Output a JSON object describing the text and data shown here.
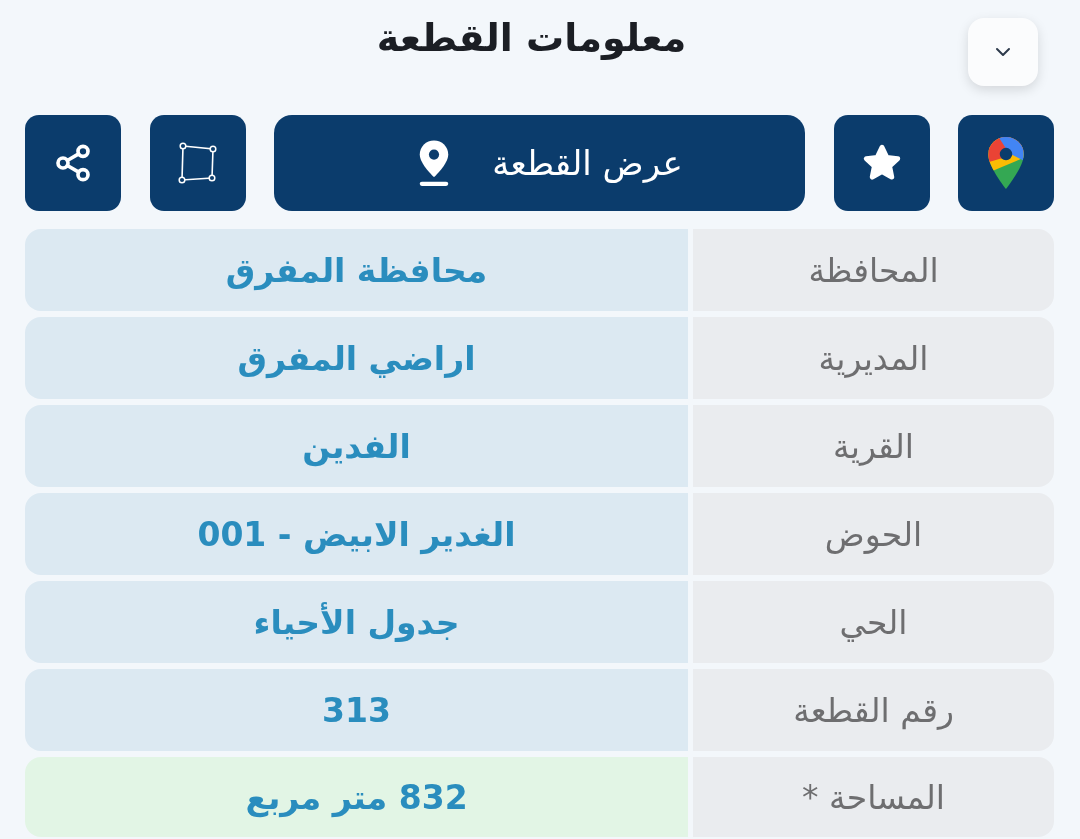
{
  "header": {
    "title": "معلومات القطعة"
  },
  "actions": [
    {
      "kind": "maps"
    },
    {
      "kind": "favorite"
    },
    {
      "kind": "view",
      "label": "عرض القطعة"
    },
    {
      "kind": "polygon"
    },
    {
      "kind": "share"
    }
  ],
  "rows": [
    {
      "label": "المحافظة",
      "value": "محافظة المفرق",
      "highlighted": false
    },
    {
      "label": "المديرية",
      "value": "اراضي المفرق",
      "highlighted": false
    },
    {
      "label": "القرية",
      "value": "الفدين",
      "highlighted": false
    },
    {
      "label": "الحوض",
      "value": "الغدير الابيض - 001",
      "highlighted": false
    },
    {
      "label": "الحي",
      "value": "جدول الأحياء",
      "highlighted": false
    },
    {
      "label": "رقم القطعة",
      "value": "313",
      "highlighted": false
    },
    {
      "label": "المساحة *",
      "value": "832 متر مربع",
      "highlighted": true
    }
  ]
}
